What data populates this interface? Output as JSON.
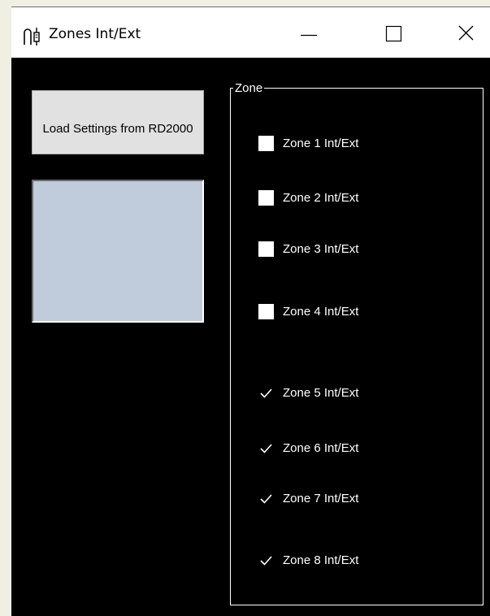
{
  "window": {
    "title": "Zones Int/Ext"
  },
  "buttons": {
    "load_settings": "Load Settings from RD2000"
  },
  "zone_group": {
    "legend": "Zone",
    "zones": [
      {
        "label": "Zone 1 Int/Ext",
        "checked": false
      },
      {
        "label": "Zone 2 Int/Ext",
        "checked": false
      },
      {
        "label": "Zone 3 Int/Ext",
        "checked": false
      },
      {
        "label": "Zone 4 Int/Ext",
        "checked": false
      },
      {
        "label": "Zone 5 Int/Ext",
        "checked": true
      },
      {
        "label": "Zone 6 Int/Ext",
        "checked": true
      },
      {
        "label": "Zone 7 Int/Ext",
        "checked": true
      },
      {
        "label": "Zone 8 Int/Ext",
        "checked": true
      }
    ]
  },
  "colors": {
    "client_background": "#000000",
    "titlebar": "#ffffff",
    "button_face": "#e1e1e1",
    "status_panel": "#c0ccdb",
    "text": "#ffffff"
  },
  "icons": {
    "app": "plug-icon",
    "minimize": "minimize-icon",
    "maximize": "maximize-icon",
    "close": "close-icon"
  }
}
